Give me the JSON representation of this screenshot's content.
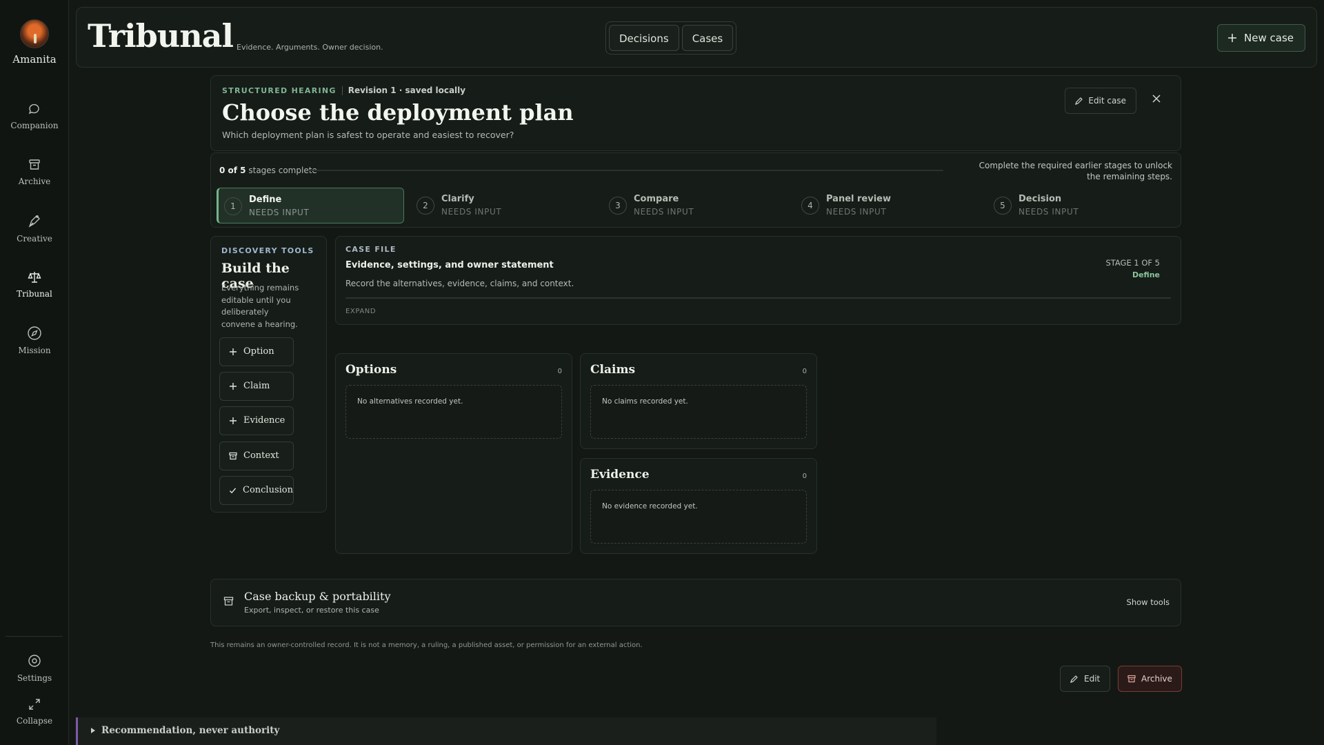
{
  "sidebar": {
    "brand": "Amanita",
    "items": [
      {
        "label": "Companion",
        "icon": "chat-bubble-icon"
      },
      {
        "label": "Archive",
        "icon": "archive-box-icon"
      },
      {
        "label": "Creative",
        "icon": "pen-nib-icon"
      },
      {
        "label": "Tribunal",
        "icon": "scales-icon",
        "active": true
      },
      {
        "label": "Mission",
        "icon": "compass-icon"
      }
    ],
    "settings": "Settings",
    "collapse": "Collapse"
  },
  "header": {
    "title": "Tribunal",
    "tagline": "Evidence. Arguments. Owner decision.",
    "tabs": [
      "Decisions",
      "Cases"
    ],
    "new_case": "New case"
  },
  "hearing": {
    "eyebrow": "STRUCTURED HEARING",
    "revision": "Revision 1 · saved locally",
    "title": "Choose the deployment plan",
    "question": "Which deployment plan is safest to operate and easiest to recover?",
    "edit_case": "Edit case"
  },
  "progress": {
    "complete_count": "0 of 5",
    "complete_suffix": "stages complete",
    "hint": "Complete the required earlier stages to unlock the remaining steps.",
    "stages": [
      {
        "num": "1",
        "name": "Define",
        "status": "NEEDS INPUT",
        "active": true
      },
      {
        "num": "2",
        "name": "Clarify",
        "status": "NEEDS INPUT"
      },
      {
        "num": "3",
        "name": "Compare",
        "status": "NEEDS INPUT"
      },
      {
        "num": "4",
        "name": "Panel review",
        "status": "NEEDS INPUT"
      },
      {
        "num": "5",
        "name": "Decision",
        "status": "NEEDS INPUT"
      }
    ]
  },
  "discovery": {
    "eyebrow": "DISCOVERY TOOLS",
    "title": "Build the case",
    "desc": "Everything remains editable until you deliberately convene a hearing.",
    "tools": [
      {
        "label": "Option",
        "icon": "plus-icon"
      },
      {
        "label": "Claim",
        "icon": "plus-icon"
      },
      {
        "label": "Evidence",
        "icon": "plus-icon"
      },
      {
        "label": "Context",
        "icon": "archive-box-icon"
      },
      {
        "label": "Conclusion",
        "icon": "check-icon"
      }
    ]
  },
  "case_file": {
    "eyebrow": "CASE FILE",
    "title": "Evidence, settings, and owner statement",
    "desc": "Record the alternatives, evidence, claims, and context.",
    "stage_label": "STAGE 1 OF 5",
    "stage_name": "Define",
    "expand": "EXPAND"
  },
  "columns": {
    "options": {
      "title": "Options",
      "count": "0",
      "empty": "No alternatives recorded yet."
    },
    "claims": {
      "title": "Claims",
      "count": "0",
      "empty": "No claims recorded yet."
    },
    "evidence": {
      "title": "Evidence",
      "count": "0",
      "empty": "No evidence recorded yet."
    }
  },
  "backup": {
    "title": "Case backup & portability",
    "desc": "Export, inspect, or restore this case",
    "show_tools": "Show tools"
  },
  "disclaimer": "This remains an owner-controlled record. It is not a memory, a ruling, a published asset, or permission for an external action.",
  "actions": {
    "edit": "Edit",
    "archive": "Archive"
  },
  "recommendation": "Recommendation, never authority",
  "colors": {
    "accent": "#74b58b",
    "danger": "#7a3b34",
    "reco_border": "#7e5aa8"
  }
}
